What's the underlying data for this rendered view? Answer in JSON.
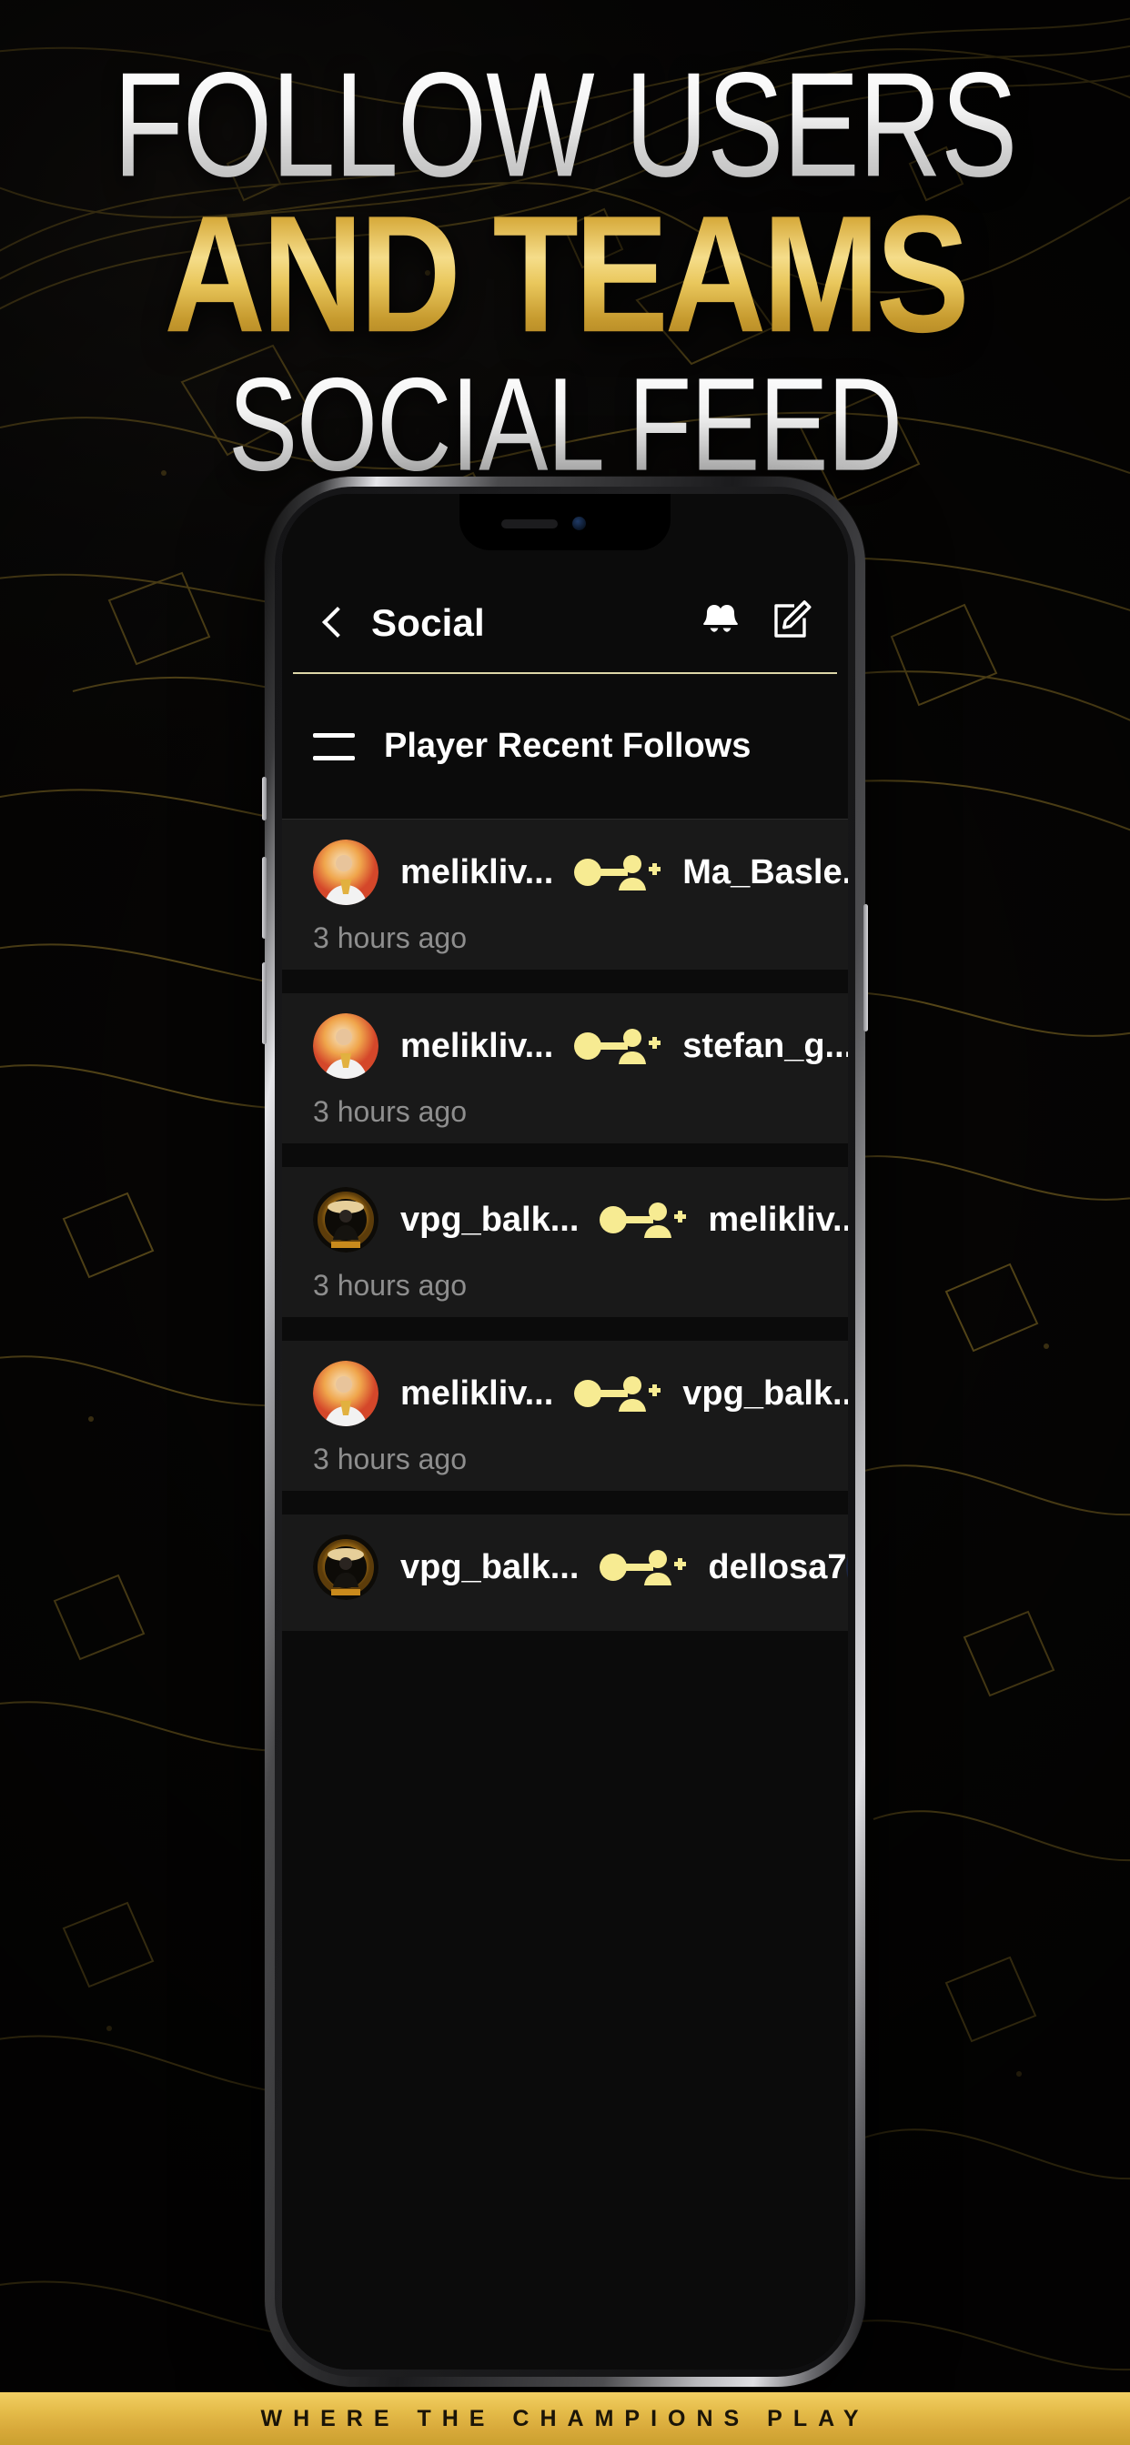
{
  "promo": {
    "headline_line1": "FOLLOW USERS",
    "headline_line2": "AND TEAMS",
    "headline_line3": "SOCIAL FEED",
    "footer_tagline": "WHERE THE CHAMPIONS PLAY",
    "colors": {
      "gold": "#e9c75c",
      "gold_deep": "#a87d1e",
      "white": "#ffffff",
      "background": "#080706",
      "banner_gold": "#e5bc4a"
    }
  },
  "app": {
    "appbar": {
      "back_icon": "chevron-left-icon",
      "title": "Social",
      "notifications_icon": "bells-icon",
      "compose_icon": "compose-pencil-icon"
    },
    "section": {
      "menu_icon": "hamburger-icon",
      "title": "Player Recent Follows"
    },
    "feed": [
      {
        "follower": "melikliv...",
        "action_icon": "follow-link-icon",
        "followed": "Ma_Basle...",
        "timestamp": "3 hours ago",
        "follower_avatar": "melik-avatar",
        "followed_avatar": "ma-basler-crest-avatar"
      },
      {
        "follower": "melikliv...",
        "action_icon": "follow-link-icon",
        "followed": "stefan_g...",
        "timestamp": "3 hours ago",
        "follower_avatar": "melik-avatar",
        "followed_avatar": "stefan-avatar"
      },
      {
        "follower": "vpg_balk...",
        "action_icon": "follow-link-icon",
        "followed": "melikliv...",
        "timestamp": "3 hours ago",
        "follower_avatar": "vpg-crest-avatar",
        "followed_avatar": "melik-avatar"
      },
      {
        "follower": "melikliv...",
        "action_icon": "follow-link-icon",
        "followed": "vpg_balk...",
        "timestamp": "3 hours ago",
        "follower_avatar": "melik-avatar",
        "followed_avatar": "vpg-crest-avatar"
      },
      {
        "follower": "vpg_balk...",
        "action_icon": "follow-link-icon",
        "followed": "dellosa7",
        "timestamp": "",
        "follower_avatar": "vpg-crest-avatar",
        "followed_avatar": "dellosa-avatar"
      }
    ]
  }
}
